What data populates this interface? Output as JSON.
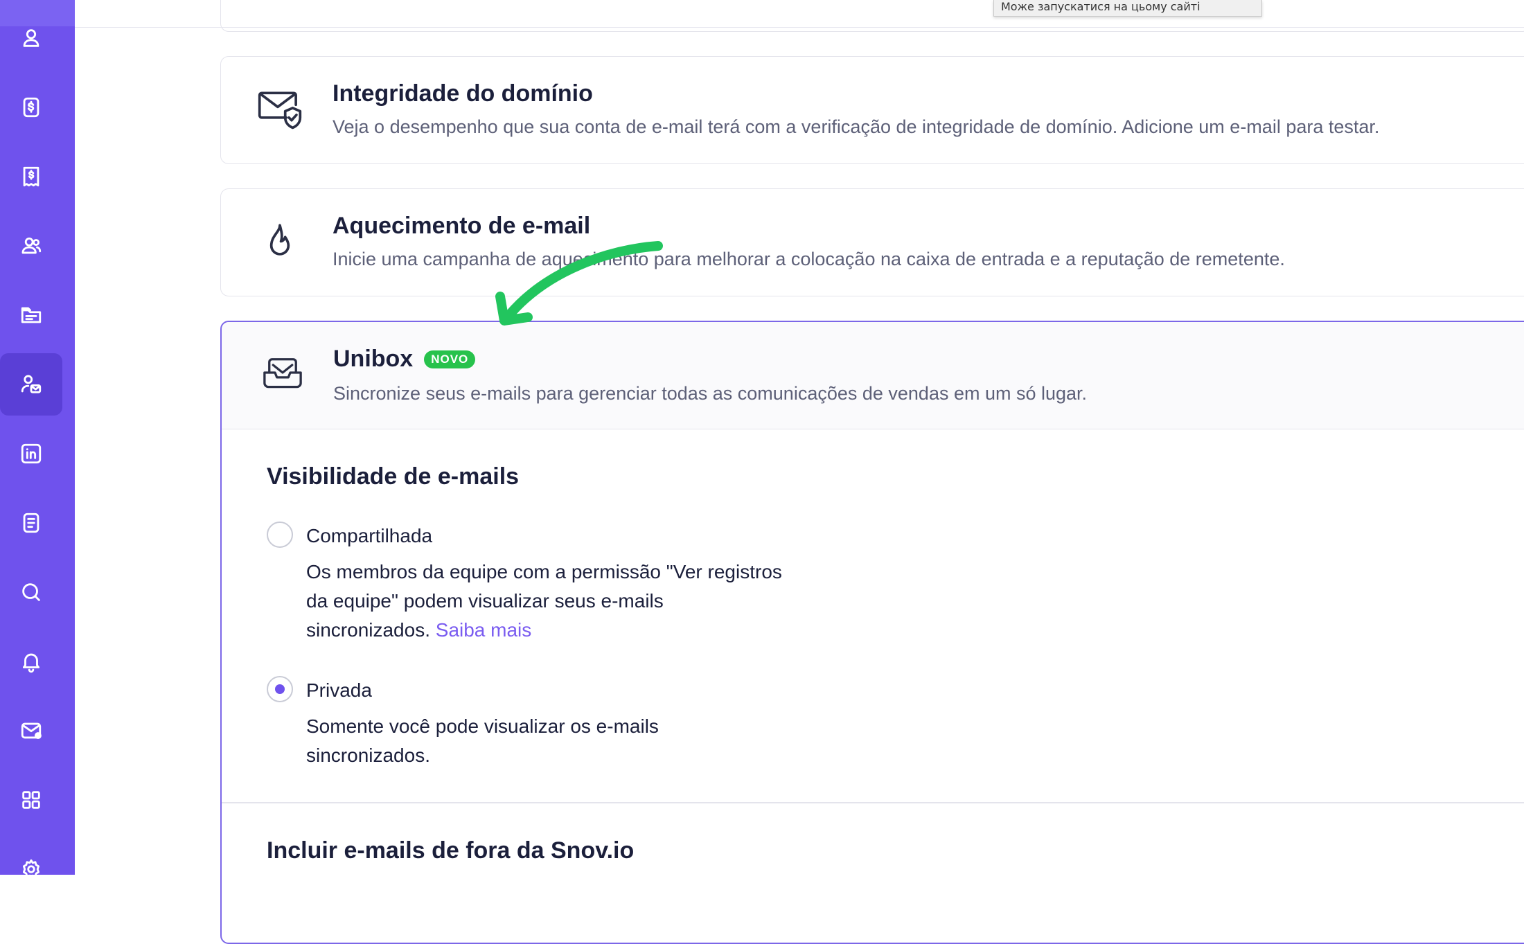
{
  "tooltip": {
    "text": "Може запускатися на цьому сайті"
  },
  "sidebar": {
    "items": [
      {
        "icon": "user-icon"
      },
      {
        "icon": "dollar-icon"
      },
      {
        "icon": "receipt-icon"
      },
      {
        "icon": "users-icon"
      },
      {
        "icon": "folder-icon"
      },
      {
        "icon": "user-mail-icon",
        "active": true
      },
      {
        "icon": "linkedin-icon"
      },
      {
        "icon": "document-icon"
      },
      {
        "icon": "search-icon"
      },
      {
        "icon": "bell-icon"
      },
      {
        "icon": "mail-icon"
      },
      {
        "icon": "apps-icon"
      },
      {
        "icon": "gear-icon"
      }
    ],
    "colors": {
      "background": "#6f52ed",
      "active": "#5a3fd6"
    }
  },
  "cards": {
    "domain": {
      "title": "Integridade do domínio",
      "description": "Veja o desempenho que sua conta de e-mail terá com a verificação de integridade de domínio. Adicione um e-mail para testar."
    },
    "warmup": {
      "title": "Aquecimento de e-mail",
      "description": "Inicie uma campanha de aquecimento para melhorar a colocação na caixa de entrada e a reputação de remetente."
    },
    "unibox": {
      "title": "Unibox",
      "badge": "NOVO",
      "description": "Sincronize seus e-mails para gerenciar todas as comunicações de vendas em um só lugar."
    }
  },
  "visibility": {
    "title": "Visibilidade de e-mails",
    "shared": {
      "label": "Compartilhada",
      "description": "Os membros da equipe com a permissão \"Ver registros da equipe\" podem visualizar seus e-mails sincronizados.",
      "link": "Saiba mais",
      "selected": false
    },
    "private": {
      "label": "Privada",
      "description": "Somente você pode visualizar os e-mails sincronizados.",
      "selected": true
    }
  },
  "external": {
    "title": "Incluir e-mails de fora da Snov.io"
  },
  "colors": {
    "accent": "#6f52ed",
    "badge": "#27c24c",
    "arrow": "#22c55e",
    "link": "#7a5cf0"
  }
}
